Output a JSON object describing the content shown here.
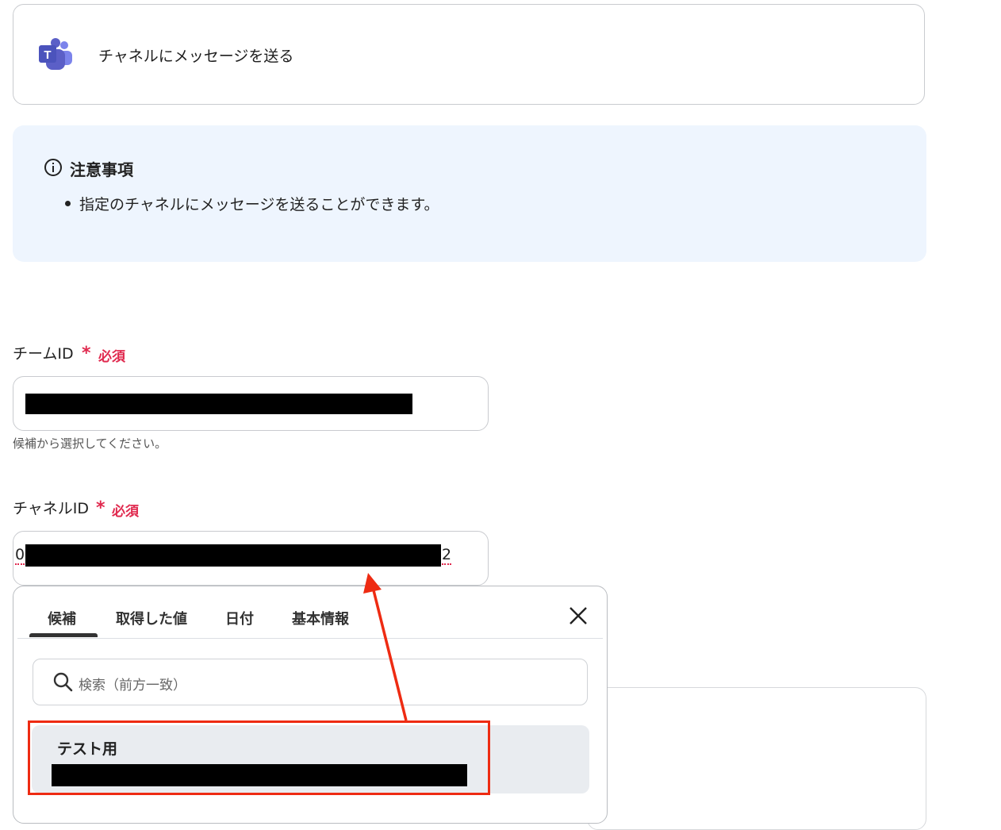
{
  "action": {
    "title": "チャネルにメッセージを送る",
    "icon": "microsoft-teams-logo"
  },
  "notice": {
    "title": "注意事項",
    "items": [
      "指定のチャネルにメッセージを送ることができます。"
    ]
  },
  "team_field": {
    "label": "チームID",
    "required_star": "*",
    "required_text": "必須",
    "hint": "候補から選択してください。"
  },
  "channel_field": {
    "label": "チャネルID",
    "required_star": "*",
    "required_text": "必須",
    "value_start": "0",
    "value_end": "2"
  },
  "popup": {
    "tabs": [
      "候補",
      "取得した値",
      "日付",
      "基本情報"
    ],
    "active_tab": "候補",
    "search_placeholder": "検索（前方一致）",
    "options": [
      {
        "title": "テスト用"
      }
    ]
  },
  "colors": {
    "accent_red": "#e0294e",
    "highlight": "#ee2b12",
    "notice_bg": "#eef5fe",
    "teams_purple": "#5b5fc7"
  }
}
